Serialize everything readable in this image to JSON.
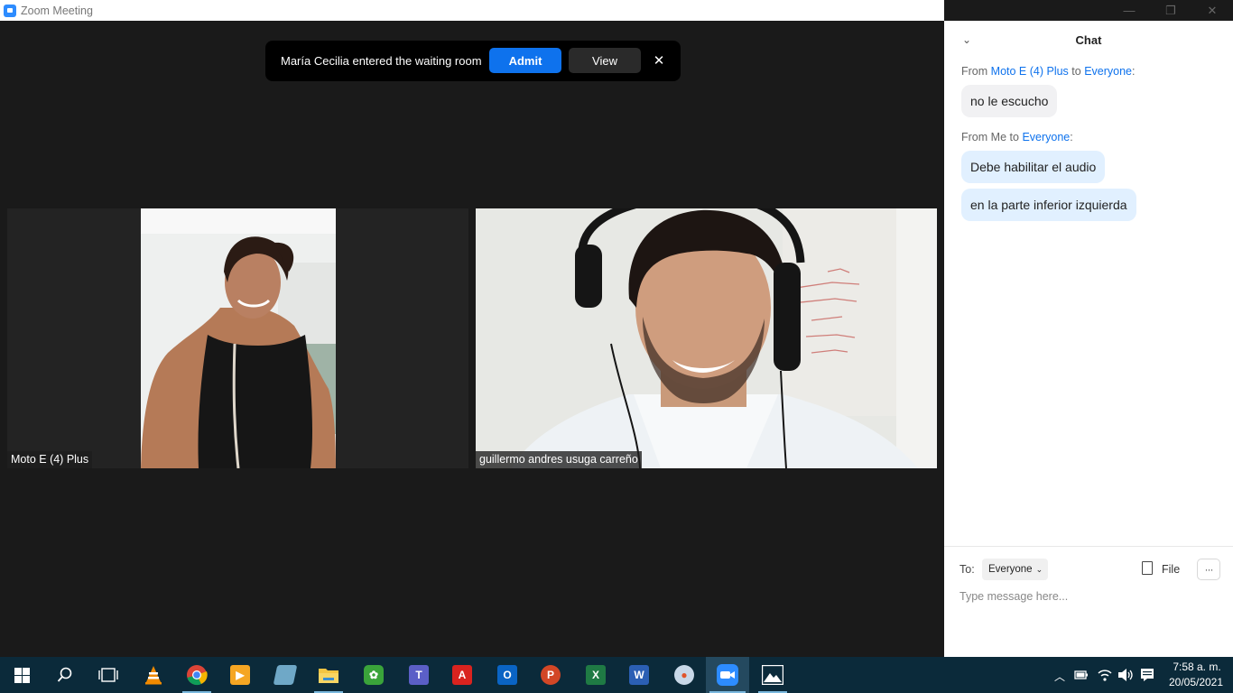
{
  "window": {
    "title": "Zoom Meeting",
    "minimize": "—",
    "restore": "❐",
    "close": "✕"
  },
  "banner": {
    "message": "María Cecilia entered the waiting room",
    "admit_label": "Admit",
    "view_label": "View",
    "close_glyph": "✕"
  },
  "participants": [
    {
      "name": "Moto E (4) Plus"
    },
    {
      "name": "guillermo andres usuga carreño"
    }
  ],
  "chat": {
    "title": "Chat",
    "collapse_glyph": "⌄",
    "messages": [
      {
        "from_prefix": "From",
        "sender": "Moto E (4) Plus",
        "to_word": "to",
        "recipient": "Everyone",
        "suffix": ":",
        "lines": [
          "no le escucho"
        ]
      },
      {
        "from_prefix": "From",
        "sender": "Me",
        "to_word": "to",
        "recipient": "Everyone",
        "suffix": ":",
        "lines": [
          "Debe habilitar el audio",
          "en la parte inferior izquierda"
        ]
      }
    ],
    "to_label": "To:",
    "to_value": "Everyone",
    "to_chevron": "⌄",
    "file_label": "File",
    "more_glyph": "···",
    "input_placeholder": "Type message here..."
  },
  "taskbar": {
    "apps": [
      "start",
      "search",
      "task-view",
      "vlc",
      "chrome",
      "media-player",
      "notes",
      "file-explorer",
      "greenshot",
      "teams",
      "acrobat",
      "outlook",
      "powerpoint",
      "excel",
      "word",
      "paint",
      "zoom",
      "photos"
    ],
    "tray_chevron": "︿",
    "clock_time": "7:58 a. m.",
    "clock_date": "20/05/2021"
  },
  "colors": {
    "accent": "#0e72ed",
    "meeting_bg": "#1a1a1a",
    "taskbar_bg": "#0b2a3a",
    "my_bubble": "#e1f0ff",
    "their_bubble": "#f1f1f3"
  }
}
